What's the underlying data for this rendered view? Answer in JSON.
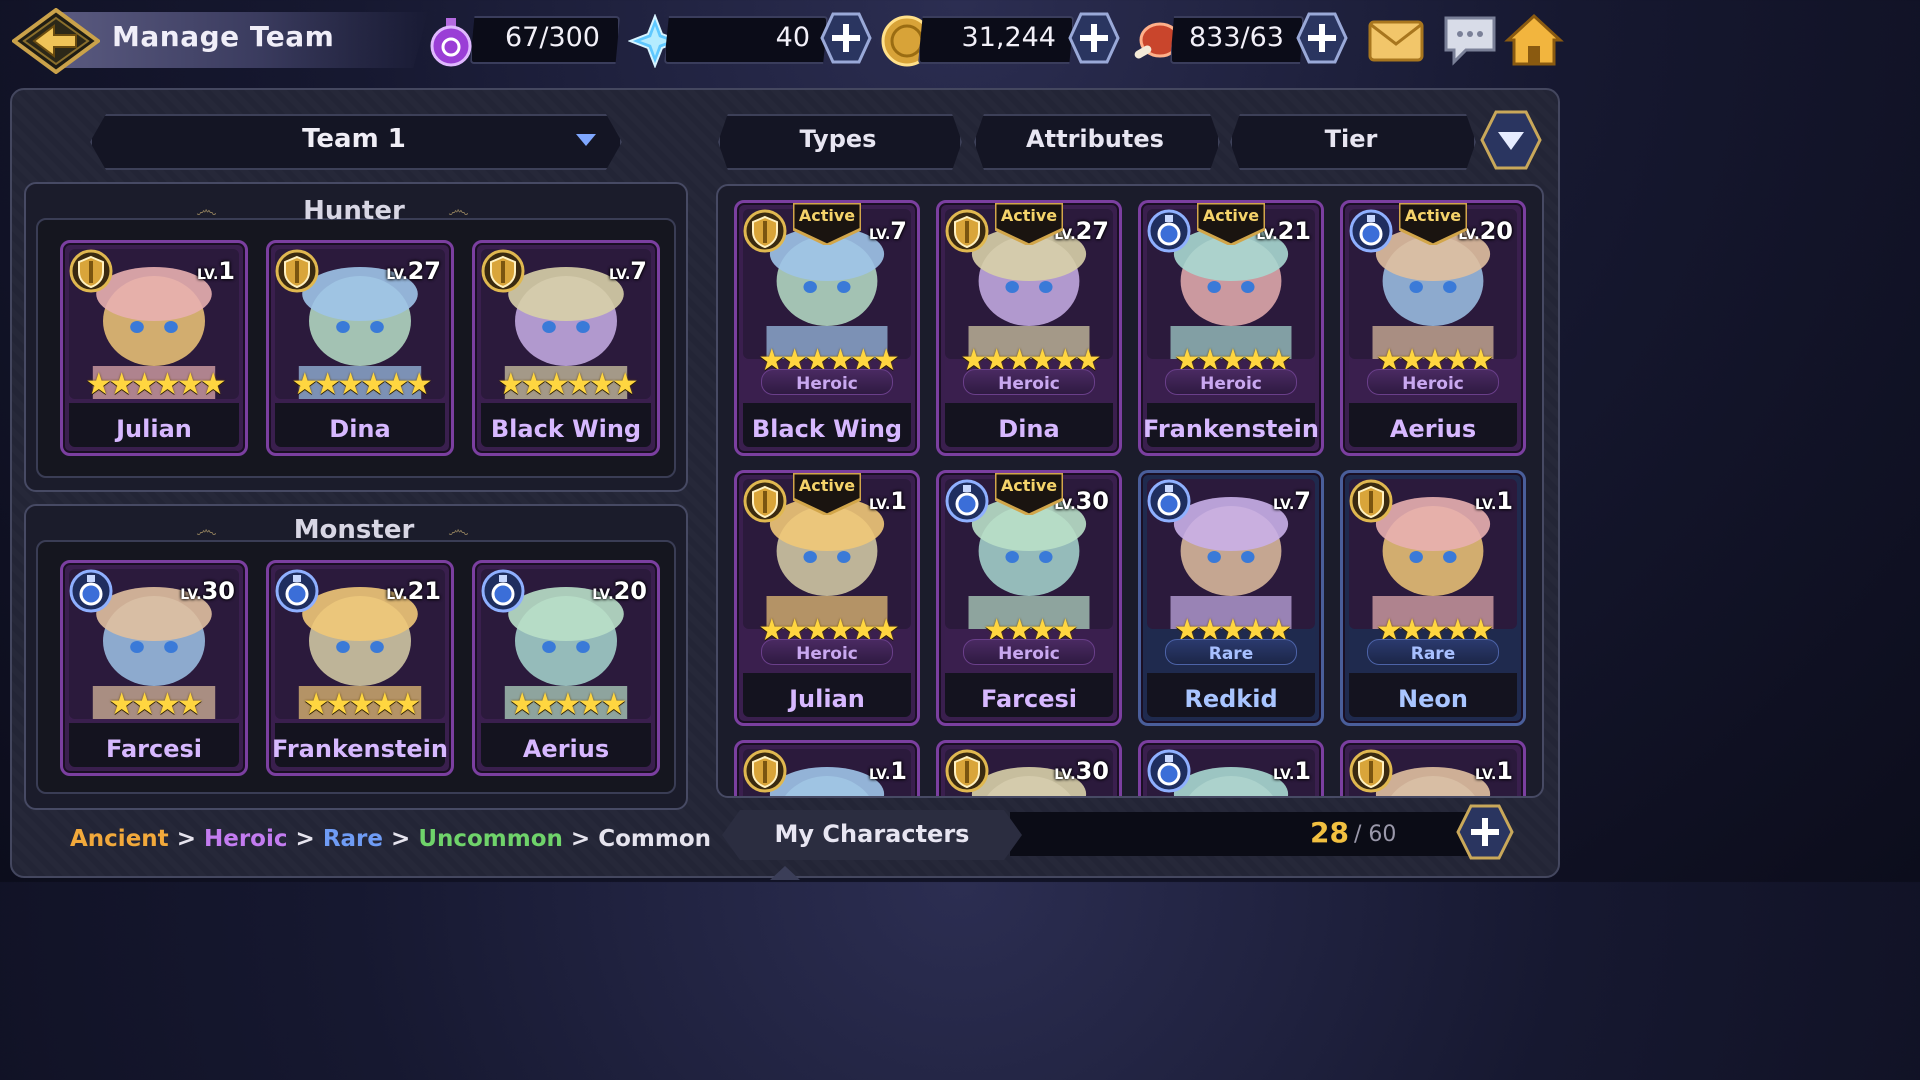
{
  "header": {
    "title": "Manage Team",
    "stamina": "67/300",
    "gems": "40",
    "gold": "31,244",
    "food": "833/63"
  },
  "team_select": {
    "selected": "Team 1"
  },
  "filters": {
    "types": "Types",
    "attributes": "Attributes",
    "tier": "Tier"
  },
  "hunter_section": {
    "title": "Hunter",
    "slots": [
      {
        "name": "Julian",
        "level": "1",
        "class": "shield",
        "stars": 6
      },
      {
        "name": "Dina",
        "level": "27",
        "class": "shield",
        "stars": 6
      },
      {
        "name": "Black Wing",
        "level": "7",
        "class": "shield",
        "stars": 6
      }
    ]
  },
  "monster_section": {
    "title": "Monster",
    "slots": [
      {
        "name": "Farcesi",
        "level": "30",
        "class": "potion",
        "stars": 4
      },
      {
        "name": "Frankenstein",
        "level": "21",
        "class": "potion",
        "stars": 5
      },
      {
        "name": "Aerius",
        "level": "20",
        "class": "potion",
        "stars": 5
      }
    ]
  },
  "roster": [
    {
      "name": "Black Wing",
      "level": "7",
      "tier": "Heroic",
      "active": "Active",
      "class": "shield",
      "stars": 6
    },
    {
      "name": "Dina",
      "level": "27",
      "tier": "Heroic",
      "active": "Active",
      "class": "shield",
      "stars": 6
    },
    {
      "name": "Frankenstein",
      "level": "21",
      "tier": "Heroic",
      "active": "Active",
      "class": "potion",
      "stars": 5
    },
    {
      "name": "Aerius",
      "level": "20",
      "tier": "Heroic",
      "active": "Active",
      "class": "potion",
      "stars": 5
    },
    {
      "name": "Julian",
      "level": "1",
      "tier": "Heroic",
      "active": "Active",
      "class": "shield",
      "stars": 6
    },
    {
      "name": "Farcesi",
      "level": "30",
      "tier": "Heroic",
      "active": "Active",
      "class": "potion",
      "stars": 4
    },
    {
      "name": "Redkid",
      "level": "7",
      "tier": "Rare",
      "active": "",
      "class": "potion",
      "stars": 5
    },
    {
      "name": "Neon",
      "level": "1",
      "tier": "Rare",
      "active": "",
      "class": "shield",
      "stars": 5
    },
    {
      "name": "",
      "level": "1",
      "tier": "",
      "active": "",
      "class": "shield",
      "stars": 0
    },
    {
      "name": "",
      "level": "30",
      "tier": "",
      "active": "",
      "class": "shield",
      "stars": 0
    },
    {
      "name": "",
      "level": "1",
      "tier": "",
      "active": "",
      "class": "potion",
      "stars": 0
    },
    {
      "name": "",
      "level": "1",
      "tier": "",
      "active": "",
      "class": "shield",
      "stars": 0
    }
  ],
  "tier_legend": {
    "ancient": "Ancient",
    "heroic": "Heroic",
    "rare": "Rare",
    "uncommon": "Uncommon",
    "common": "Common",
    "sep": ">",
    "colors": {
      "ancient": "#f2a93b",
      "heroic": "#c37cf0",
      "rare": "#6f9cf5",
      "uncommon": "#6fd36a",
      "common": "#e6e4ee"
    }
  },
  "footer": {
    "tab_label": "My Characters",
    "count_current": "28",
    "count_max": "/ 60"
  },
  "level_prefix": "LV."
}
